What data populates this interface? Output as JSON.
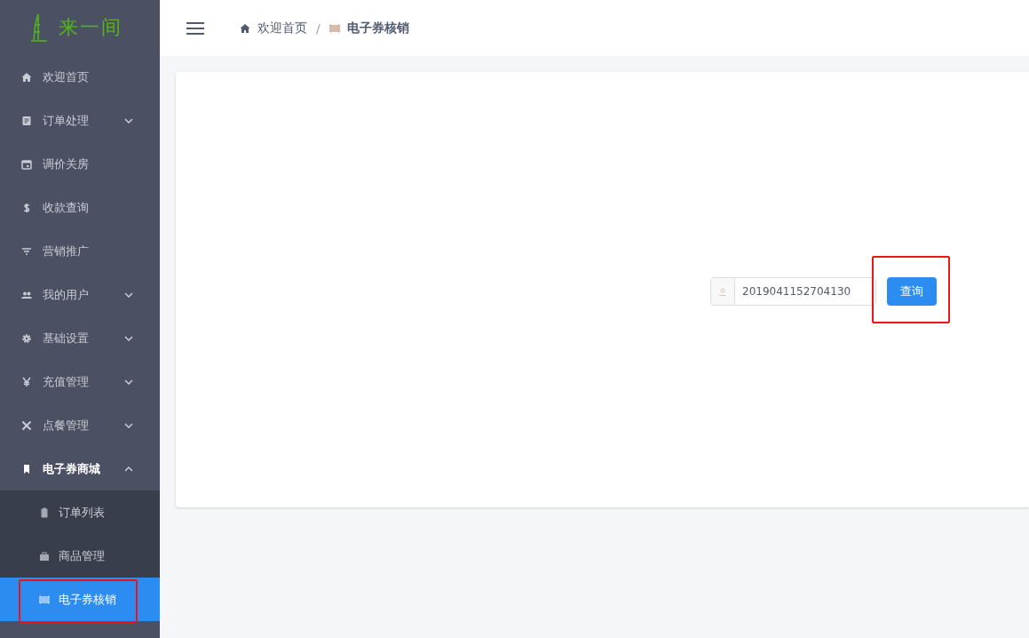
{
  "logo": {
    "text": "来一间"
  },
  "sidebar": {
    "items": [
      {
        "label": "欢迎首页"
      },
      {
        "label": "订单处理",
        "expanded": false
      },
      {
        "label": "调价关房"
      },
      {
        "label": "收款查询"
      },
      {
        "label": "营销推广"
      },
      {
        "label": "我的用户",
        "expanded": false
      },
      {
        "label": "基础设置",
        "expanded": false
      },
      {
        "label": "充值管理",
        "expanded": false
      },
      {
        "label": "点餐管理",
        "expanded": false
      },
      {
        "label": "电子券商城",
        "expanded": true,
        "children": [
          {
            "label": "订单列表",
            "selected": false
          },
          {
            "label": "商品管理",
            "selected": false
          },
          {
            "label": "电子券核销",
            "selected": true
          }
        ]
      }
    ]
  },
  "breadcrumb": {
    "separator": "/",
    "items": [
      {
        "label": "欢迎首页"
      },
      {
        "label": "电子券核销"
      }
    ]
  },
  "search": {
    "value": "2019041152704130",
    "button": "查询"
  }
}
